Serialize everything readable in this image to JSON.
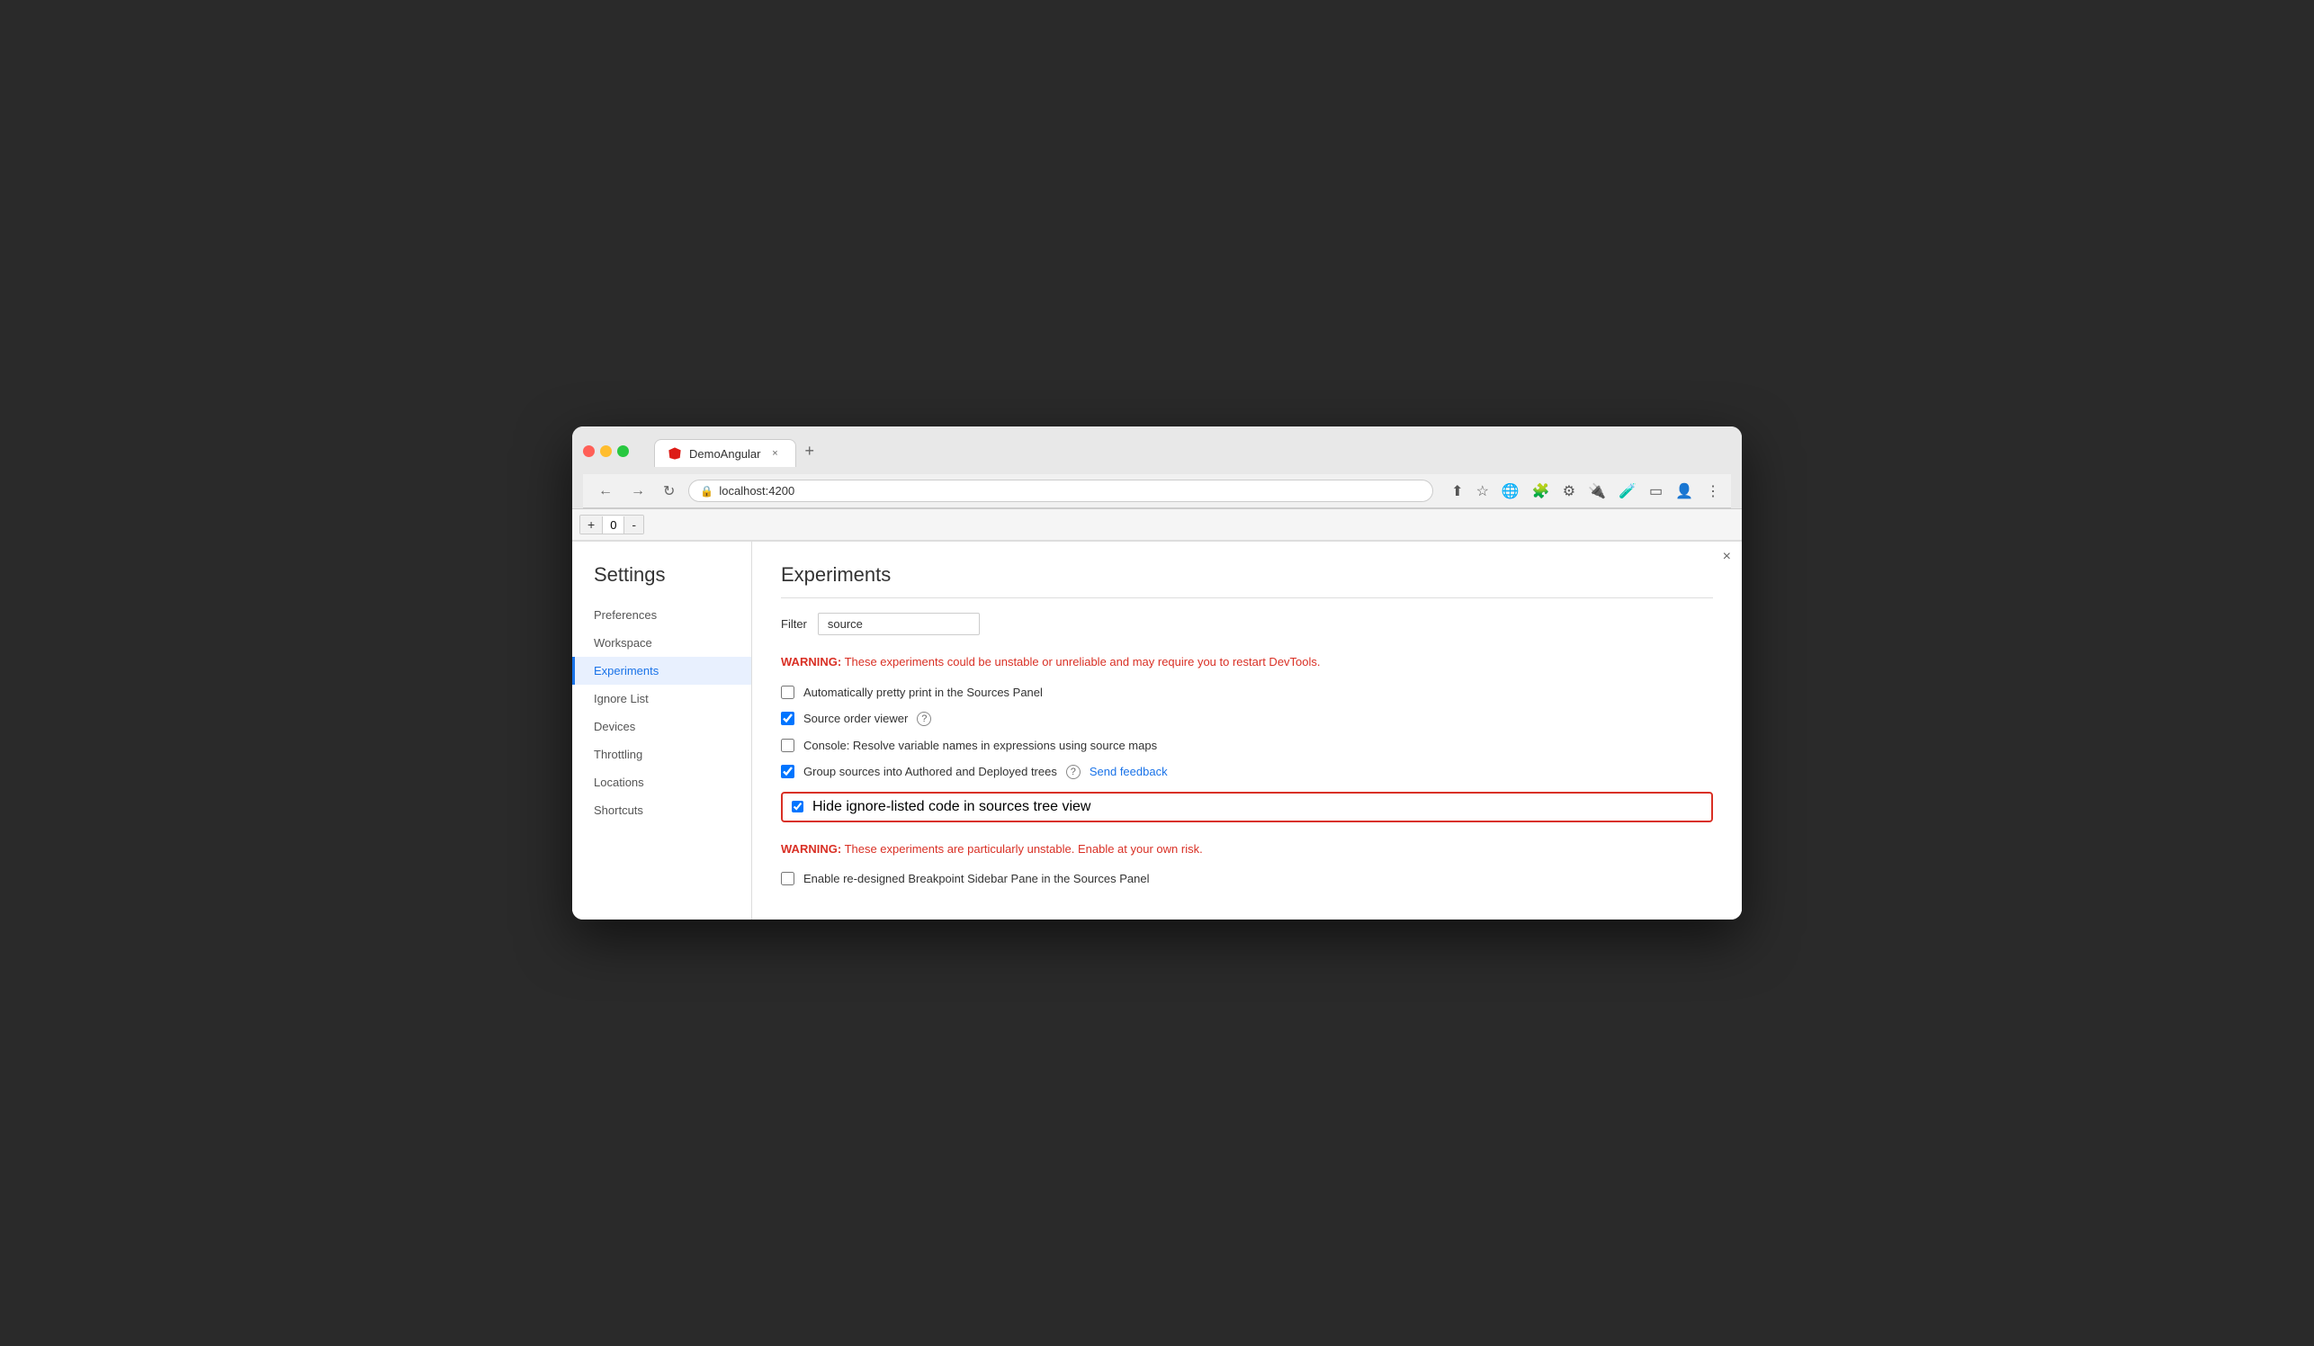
{
  "browser": {
    "traffic_lights": [
      "red",
      "yellow",
      "green"
    ],
    "tab": {
      "title": "DemoAngular",
      "close_label": "×"
    },
    "tab_new_label": "+",
    "address": "localhost:4200",
    "nav": {
      "back": "←",
      "forward": "→",
      "reload": "↻"
    }
  },
  "devtools": {
    "counter": {
      "plus": "+",
      "value": "0",
      "minus": "-"
    },
    "close": "×"
  },
  "settings": {
    "title": "Settings",
    "sidebar_items": [
      {
        "id": "preferences",
        "label": "Preferences",
        "active": false
      },
      {
        "id": "workspace",
        "label": "Workspace",
        "active": false
      },
      {
        "id": "experiments",
        "label": "Experiments",
        "active": true
      },
      {
        "id": "ignore-list",
        "label": "Ignore List",
        "active": false
      },
      {
        "id": "devices",
        "label": "Devices",
        "active": false
      },
      {
        "id": "throttling",
        "label": "Throttling",
        "active": false
      },
      {
        "id": "locations",
        "label": "Locations",
        "active": false
      },
      {
        "id": "shortcuts",
        "label": "Shortcuts",
        "active": false
      }
    ]
  },
  "experiments": {
    "title": "Experiments",
    "filter_label": "Filter",
    "filter_value": "source",
    "filter_placeholder": "Filter",
    "warning1": {
      "prefix": "WARNING:",
      "text": " These experiments could be unstable or unreliable and may require you to restart DevTools."
    },
    "items": [
      {
        "id": "auto-pretty-print",
        "label": "Automatically pretty print in the Sources Panel",
        "checked": false,
        "has_help": false,
        "has_feedback": false,
        "highlighted": false
      },
      {
        "id": "source-order-viewer",
        "label": "Source order viewer",
        "checked": true,
        "has_help": true,
        "has_feedback": false,
        "highlighted": false
      },
      {
        "id": "console-resolve",
        "label": "Console: Resolve variable names in expressions using source maps",
        "checked": false,
        "has_help": false,
        "has_feedback": false,
        "highlighted": false
      },
      {
        "id": "group-sources",
        "label": "Group sources into Authored and Deployed trees",
        "checked": true,
        "has_help": true,
        "has_feedback": true,
        "highlighted": false
      },
      {
        "id": "hide-ignore-listed",
        "label": "Hide ignore-listed code in sources tree view",
        "checked": true,
        "has_help": false,
        "has_feedback": false,
        "highlighted": true
      }
    ],
    "warning2": {
      "prefix": "WARNING:",
      "text": " These experiments are particularly unstable. Enable at your own risk."
    },
    "unstable_items": [
      {
        "id": "redesigned-breakpoint",
        "label": "Enable re-designed Breakpoint Sidebar Pane in the Sources Panel",
        "checked": false,
        "has_help": false,
        "has_feedback": false
      }
    ],
    "send_feedback_label": "Send feedback",
    "help_icon": "?"
  }
}
